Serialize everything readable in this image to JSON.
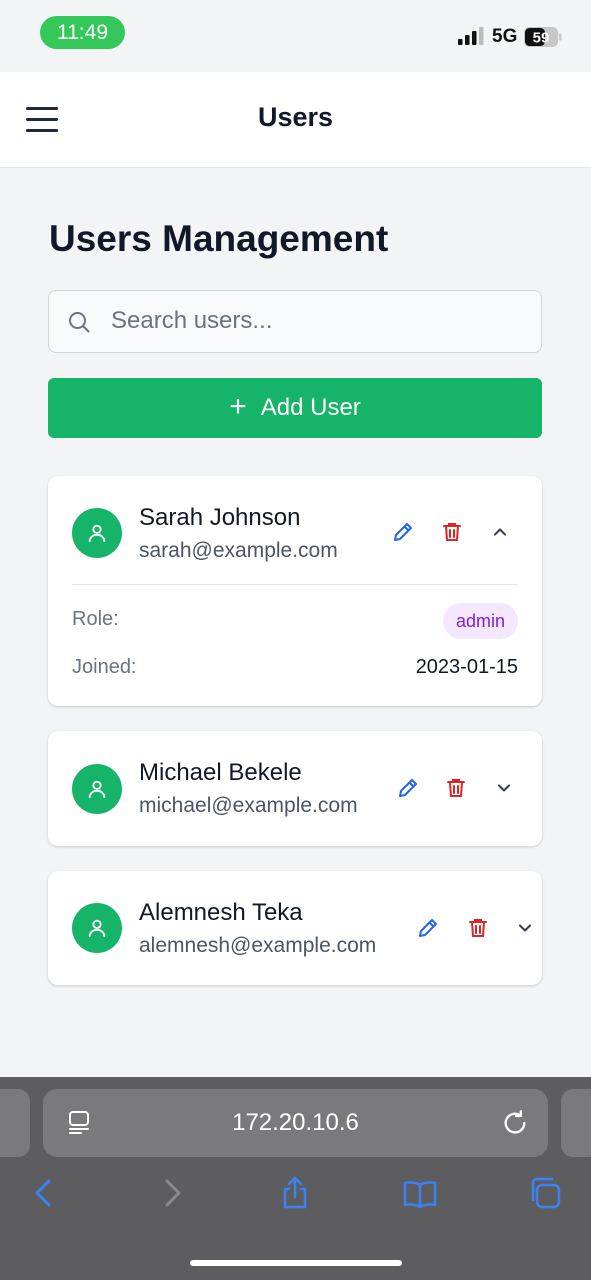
{
  "status_bar": {
    "time": "11:49",
    "network": "5G",
    "battery": "59"
  },
  "header": {
    "title": "Users"
  },
  "main": {
    "title": "Users Management",
    "search_placeholder": "Search users...",
    "add_button_label": "Add User"
  },
  "users": [
    {
      "name": "Sarah Johnson",
      "email": "sarah@example.com",
      "expanded": true,
      "role_label": "Role:",
      "role": "admin",
      "joined_label": "Joined:",
      "joined": "2023-01-15"
    },
    {
      "name": "Michael Bekele",
      "email": "michael@example.com",
      "expanded": false
    },
    {
      "name": "Alemnesh Teka",
      "email": "alemnesh@example.com",
      "expanded": false
    }
  ],
  "browser": {
    "url": "172.20.10.6"
  },
  "icons": {
    "menu": "hamburger-menu-icon",
    "search": "search-icon",
    "add": "plus-icon",
    "avatar": "user-icon",
    "edit": "pencil-icon",
    "delete": "trash-icon",
    "expand": "chevron-down-icon",
    "collapse": "chevron-up-icon",
    "back": "chevron-left-icon",
    "forward": "chevron-right-icon",
    "share": "share-icon",
    "bookmarks": "book-icon",
    "tabs": "tabs-icon",
    "reload": "reload-icon",
    "page_menu": "page-menu-icon"
  },
  "colors": {
    "accent": "#16b469",
    "edit": "#2563eb",
    "delete": "#dc2626",
    "badge_bg": "#f3e8ff",
    "badge_text": "#7e22ce",
    "status_time_bg": "#34c759"
  }
}
